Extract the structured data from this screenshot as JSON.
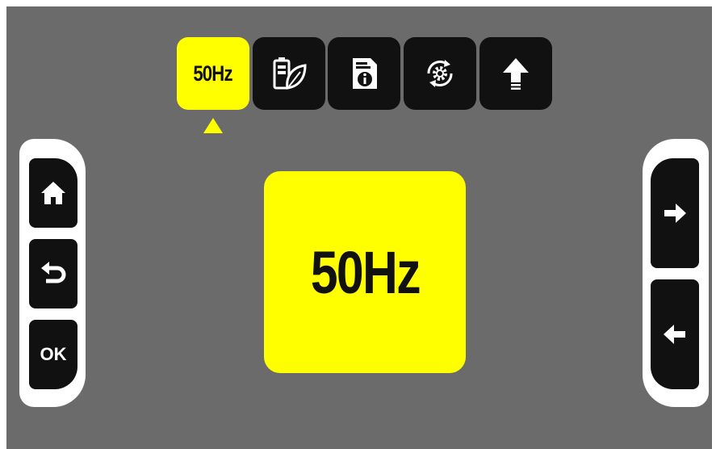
{
  "tabs": [
    {
      "name": "frequency",
      "label": "50Hz",
      "active": true
    },
    {
      "name": "eco",
      "icon": "battery-leaf-icon",
      "active": false
    },
    {
      "name": "info",
      "icon": "document-info-icon",
      "active": false
    },
    {
      "name": "settings",
      "icon": "settings-cycle-icon",
      "active": false
    },
    {
      "name": "update",
      "icon": "upload-arrow-icon",
      "active": false
    }
  ],
  "main": {
    "value_label": "50Hz"
  },
  "left_buttons": {
    "home_icon": "home-icon",
    "back_icon": "undo-arrow-icon",
    "ok_label": "OK"
  },
  "right_buttons": {
    "next_icon": "arrow-right-icon",
    "prev_icon": "arrow-left-icon"
  },
  "colors": {
    "accent": "#ffff00",
    "background": "#6b6b6b",
    "button": "#111111",
    "panel": "#ffffff"
  }
}
